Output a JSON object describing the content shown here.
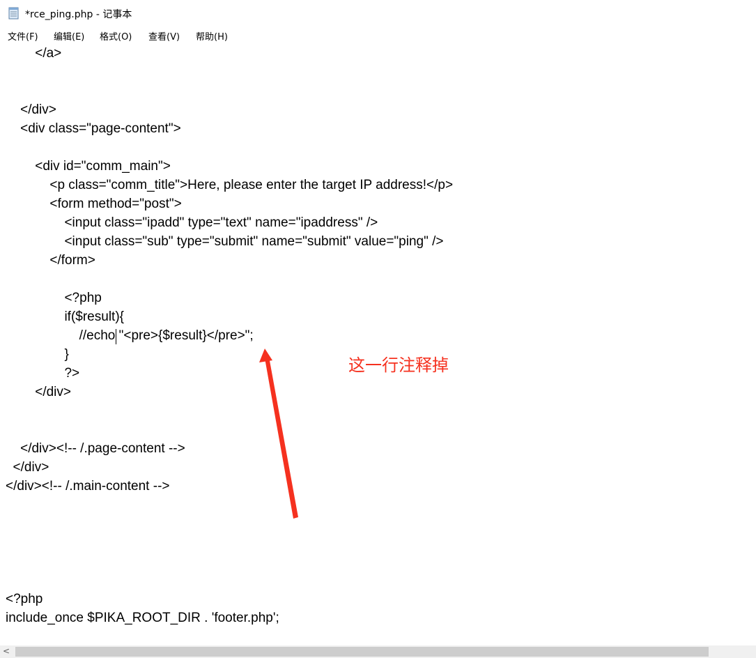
{
  "window": {
    "title": "*rce_ping.php - 记事本",
    "icon": "notepad-icon"
  },
  "menu": [
    {
      "label": "文件(F)"
    },
    {
      "label": "编辑(E)"
    },
    {
      "label": "格式(O)"
    },
    {
      "label": "查看(V)"
    },
    {
      "label": "帮助(H)"
    }
  ],
  "code_lines": [
    "        </a>",
    "",
    "",
    "    </div>",
    "    <div class=\"page-content\">",
    "",
    "        <div id=\"comm_main\">",
    "            <p class=\"comm_title\">Here, please enter the target IP address!</p>",
    "            <form method=\"post\">",
    "                <input class=\"ipadd\" type=\"text\" name=\"ipaddress\" />",
    "                <input class=\"sub\" type=\"submit\" name=\"submit\" value=\"ping\" />",
    "            </form>",
    "",
    "                <?php",
    "                if($result){",
    "                    //echo \"<pre>{$result}</pre>\";",
    "                }",
    "                ?>",
    "        </div>",
    "",
    "",
    "    </div><!-- /.page-content -->",
    "  </div>",
    "</div><!-- /.main-content -->",
    "",
    "",
    "",
    "",
    "",
    "<?php",
    "include_once $PIKA_ROOT_DIR . 'footer.php';"
  ],
  "annotation": {
    "text": "这一行注释掉",
    "color": "#f5311f"
  },
  "scrollbar": {
    "left_arrow": "<"
  }
}
